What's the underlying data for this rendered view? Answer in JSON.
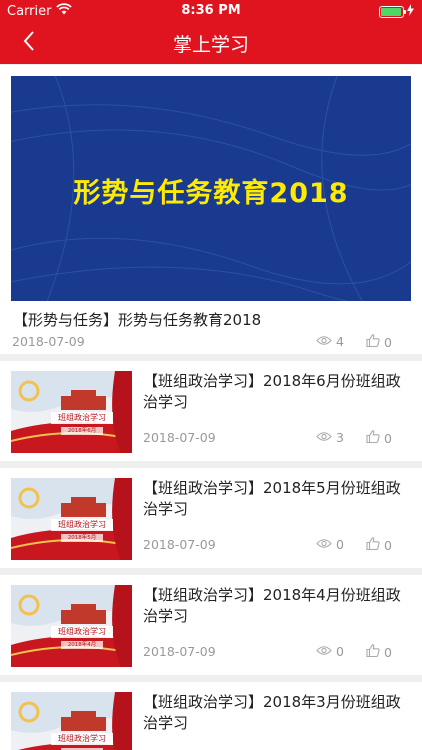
{
  "status": {
    "carrier": "Carrier",
    "time": "8:36 PM",
    "battery_level": 0.95
  },
  "nav": {
    "title": "掌上学习",
    "back_icon": "chevron-left-icon"
  },
  "colors": {
    "brand": "#e0141e",
    "banner_bg": "#1a3a8f",
    "banner_text": "#ffeb00"
  },
  "featured": {
    "banner_text": "形势与任务教育2018",
    "title": "【形势与任务】形势与任务教育2018",
    "date": "2018-07-09",
    "views": "4",
    "likes": "0"
  },
  "items": [
    {
      "title": "【班组政治学习】2018年6月份班组政治学习",
      "date": "2018-07-09",
      "views": "3",
      "likes": "0",
      "thumb_title": "班组政治学习",
      "thumb_month": "2018年6月"
    },
    {
      "title": "【班组政治学习】2018年5月份班组政治学习",
      "date": "2018-07-09",
      "views": "0",
      "likes": "0",
      "thumb_title": "班组政治学习",
      "thumb_month": "2018年5月"
    },
    {
      "title": "【班组政治学习】2018年4月份班组政治学习",
      "date": "2018-07-09",
      "views": "0",
      "likes": "0",
      "thumb_title": "班组政治学习",
      "thumb_month": "2018年4月"
    },
    {
      "title": "【班组政治学习】2018年3月份班组政治学习",
      "date": "",
      "views": "",
      "likes": "",
      "thumb_title": "班组政治学习",
      "thumb_month": ""
    }
  ]
}
